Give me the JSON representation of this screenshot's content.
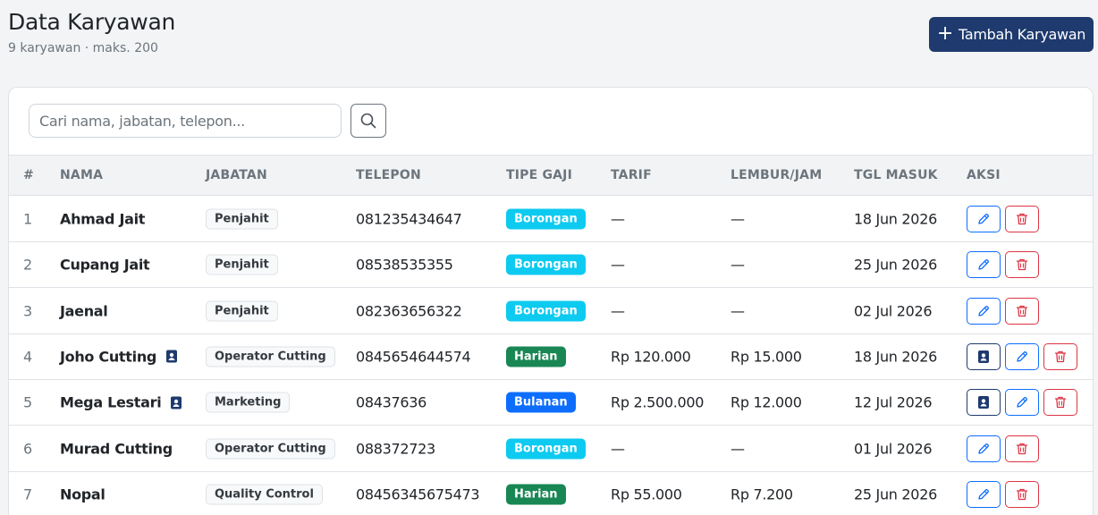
{
  "header": {
    "title": "Data Karyawan",
    "subtitle": "9 karyawan · maks. 200",
    "add_label": "Tambah Karyawan"
  },
  "search": {
    "placeholder": "Cari nama, jabatan, telepon...",
    "value": ""
  },
  "table": {
    "columns": [
      "#",
      "NAMA",
      "JABATAN",
      "TELEPON",
      "TIPE GAJI",
      "TARIF",
      "LEMBUR/JAM",
      "TGL MASUK",
      "AKSI"
    ],
    "rows": [
      {
        "no": "1",
        "name": "Ahmad Jait",
        "id_card": false,
        "role": "Penjahit",
        "phone": "081235434647",
        "pay_type": "Borongan",
        "rate": "—",
        "overtime": "—",
        "join_date": "18 Jun 2026"
      },
      {
        "no": "2",
        "name": "Cupang Jait",
        "id_card": false,
        "role": "Penjahit",
        "phone": "08538535355",
        "pay_type": "Borongan",
        "rate": "—",
        "overtime": "—",
        "join_date": "25 Jun 2026"
      },
      {
        "no": "3",
        "name": "Jaenal",
        "id_card": false,
        "role": "Penjahit",
        "phone": "082363656322",
        "pay_type": "Borongan",
        "rate": "—",
        "overtime": "—",
        "join_date": "02 Jul 2026"
      },
      {
        "no": "4",
        "name": "Joho Cutting",
        "id_card": true,
        "role": "Operator Cutting",
        "phone": "0845654644574",
        "pay_type": "Harian",
        "rate": "Rp 120.000",
        "overtime": "Rp 15.000",
        "join_date": "18 Jun 2026"
      },
      {
        "no": "5",
        "name": "Mega Lestari",
        "id_card": true,
        "role": "Marketing",
        "phone": "08437636",
        "pay_type": "Bulanan",
        "rate": "Rp 2.500.000",
        "overtime": "Rp 12.000",
        "join_date": "12 Jul 2026"
      },
      {
        "no": "6",
        "name": "Murad Cutting",
        "id_card": false,
        "role": "Operator Cutting",
        "phone": "088372723",
        "pay_type": "Borongan",
        "rate": "—",
        "overtime": "—",
        "join_date": "01 Jul 2026"
      },
      {
        "no": "7",
        "name": "Nopal",
        "id_card": false,
        "role": "Quality Control",
        "phone": "08456345675473",
        "pay_type": "Harian",
        "rate": "Rp 55.000",
        "overtime": "Rp 7.200",
        "join_date": "25 Jun 2026"
      }
    ]
  },
  "colors": {
    "primary": "#1e3a6e",
    "borongan": "#0dcaf0",
    "harian": "#198754",
    "bulanan": "#0d6efd",
    "danger": "#dc3545"
  },
  "icons": {
    "add": "plus-icon",
    "search": "search-icon",
    "id_card": "id-card-icon",
    "edit": "pencil-icon",
    "delete": "trash-icon"
  }
}
